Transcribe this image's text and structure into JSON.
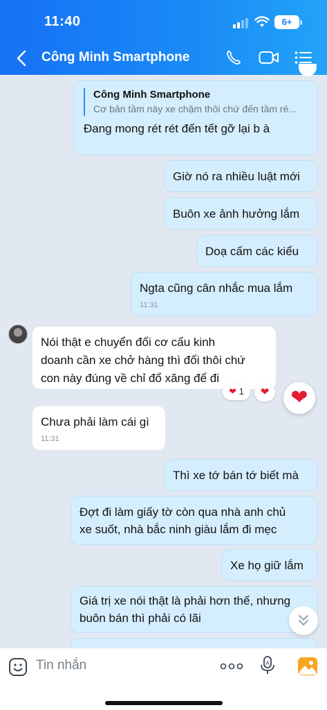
{
  "status_bar": {
    "time": "11:40",
    "battery": "6+"
  },
  "header": {
    "title": "Công Minh Smartphone"
  },
  "messages": [
    {
      "quote_name": "Công Minh Smartphone",
      "quote_text": "Cơ bản tầm này xe chậm thôi chứ đến tầm ré...",
      "text": "Đang mong rét rét đến tết gỡ lại b à"
    },
    {
      "text": "Giờ nó ra nhiều luật mới"
    },
    {
      "text": "Buôn xe ảnh hưởng lắm"
    },
    {
      "text": "Doạ cấm các kiểu"
    },
    {
      "text": "Ngta cũng cân nhắc mua lắm",
      "time": "11:31"
    },
    {
      "line1": "Nói thật e chuyển đổi cơ cấu kinh",
      "line2": "doanh cần xe chở hàng thì đổi thôi chứ",
      "line3": "con này đúng về chỉ đổ xăng để đi",
      "reaction_count": "1"
    },
    {
      "text": "Chưa phải làm cái gì",
      "time": "11:31"
    },
    {
      "text": "Thì xe tớ bán tớ biết mà"
    },
    {
      "line1": "Đợt đi làm giấy tờ còn qua nhà anh chủ",
      "line2": "xe suốt, nhà bắc ninh giàu lắm đi mẹc"
    },
    {
      "text": "Xe họ giữ lắm"
    },
    {
      "line1": "Giá trị xe nói thật là phải hơn thế, nhưng",
      "line2": "buôn bán thì phải có lãi"
    }
  ],
  "input": {
    "placeholder": "Tin nhắn"
  },
  "colors": {
    "header_start": "#1671f5",
    "header_end": "#22a3f8",
    "outgoing_bubble": "#d5eefe",
    "incoming_bubble": "#ffffff",
    "chat_bg": "#e2e8f1",
    "reaction": "#e41b33"
  }
}
